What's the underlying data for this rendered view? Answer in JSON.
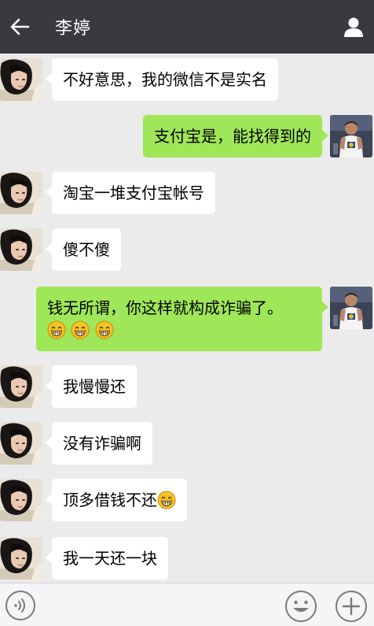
{
  "header": {
    "title": "李婷",
    "back_icon": "arrow-left-icon",
    "profile_icon": "person-icon"
  },
  "messages": [
    {
      "side": "in",
      "text": "不好意思，我的微信不是实名",
      "emoji_count": 0
    },
    {
      "side": "out",
      "text": "支付宝是，能找得到的",
      "emoji_count": 0
    },
    {
      "side": "in",
      "text": "淘宝一堆支付宝帐号",
      "emoji_count": 0
    },
    {
      "side": "in",
      "text": "傻不傻",
      "emoji_count": 0
    },
    {
      "side": "out",
      "text": "钱无所谓，你这样就构成诈骗了。",
      "emoji_count": 3
    },
    {
      "side": "in",
      "text": "我慢慢还",
      "emoji_count": 0
    },
    {
      "side": "in",
      "text": "没有诈骗啊",
      "emoji_count": 0
    },
    {
      "side": "in",
      "text": "顶多借钱不还",
      "emoji_count": 1
    },
    {
      "side": "in",
      "text": "我一天还一块",
      "emoji_count": 0
    }
  ],
  "colors": {
    "header_bg": "#393a3f",
    "chat_bg": "#ebebeb",
    "outgoing_bubble": "#9fe658",
    "incoming_bubble": "#ffffff"
  },
  "input_bar": {
    "voice_icon": "voice-icon",
    "emoji_icon": "smiley-icon",
    "more_icon": "plus-icon"
  }
}
